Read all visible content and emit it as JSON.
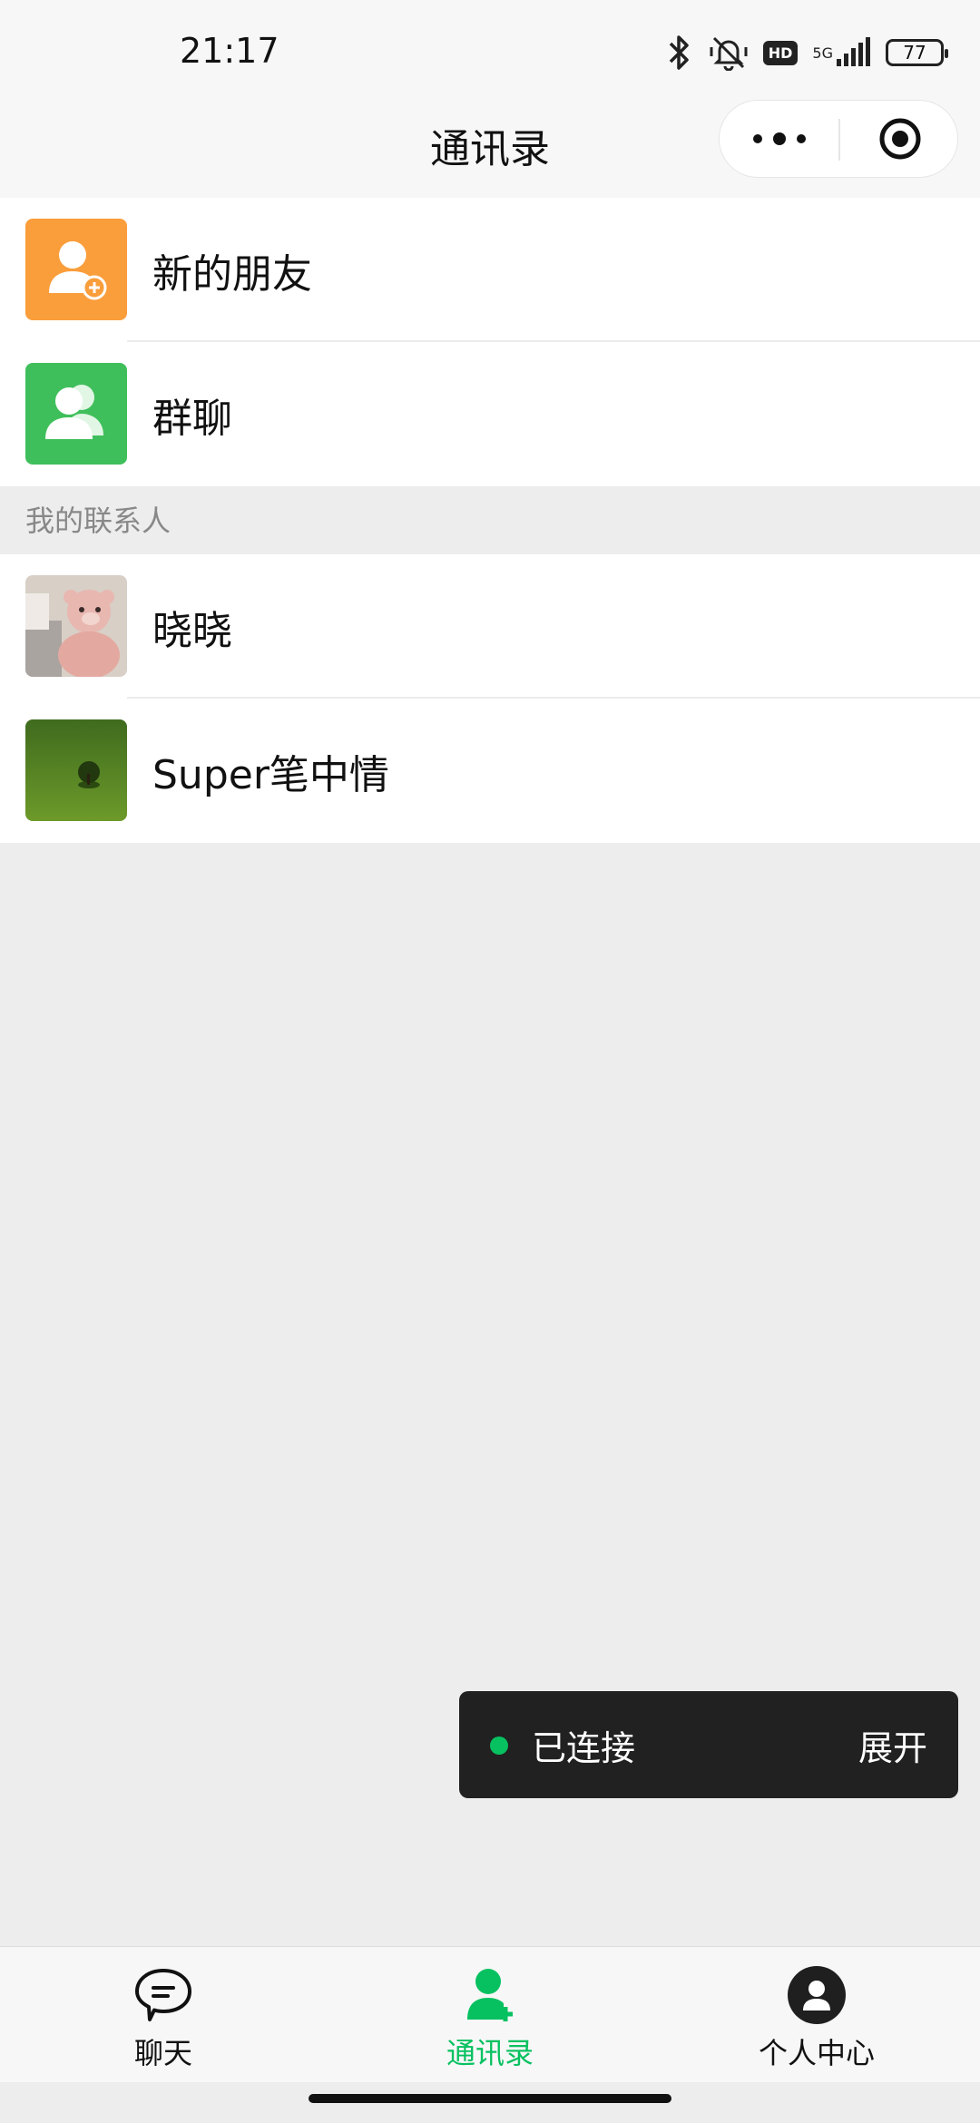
{
  "status_bar": {
    "time": "21:17",
    "hd": "HD",
    "network": "5G",
    "battery": "77"
  },
  "header": {
    "title": "通讯录"
  },
  "list_top": [
    {
      "label": "新的朋友",
      "icon": "add-friend-icon",
      "color": "#fa9d3b"
    },
    {
      "label": "群聊",
      "icon": "group-chat-icon",
      "color": "#3fbf5b"
    }
  ],
  "section": {
    "title": "我的联系人"
  },
  "contacts": [
    {
      "name": "晓晓",
      "avatar": "teddy-bear-photo"
    },
    {
      "name": "Super笔中情",
      "avatar": "tree-on-grass-photo"
    }
  ],
  "toast": {
    "status": "已连接",
    "action": "展开",
    "status_color": "#07c160"
  },
  "tabbar": {
    "tabs": [
      {
        "label": "聊天",
        "icon": "chat-bubble-icon"
      },
      {
        "label": "通讯录",
        "icon": "contacts-icon",
        "active": true
      },
      {
        "label": "个人中心",
        "icon": "profile-icon"
      }
    ]
  },
  "colors": {
    "accent": "#07c160",
    "background": "#ededed"
  }
}
